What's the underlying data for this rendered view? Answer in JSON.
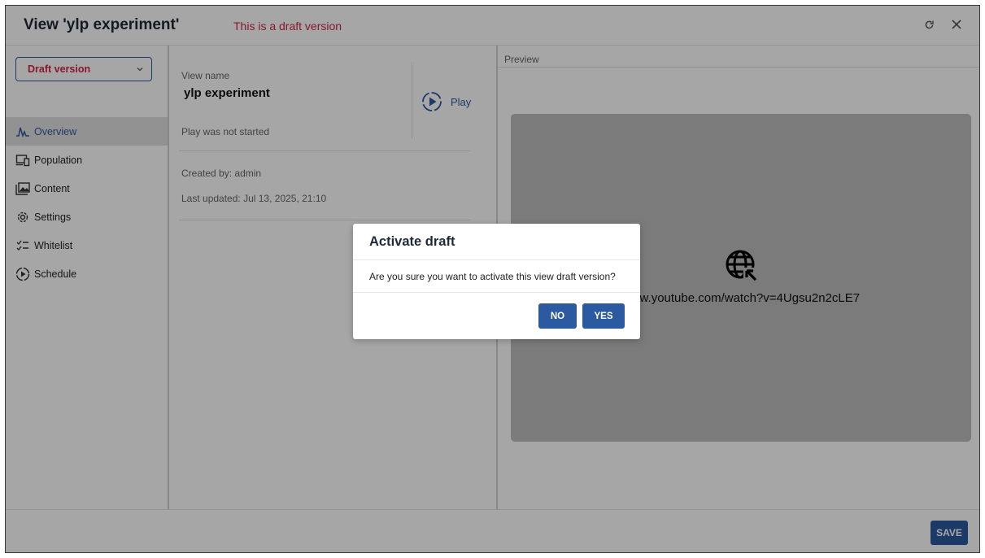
{
  "header": {
    "title": "View 'ylp experiment'",
    "draft_note": "This is a draft version",
    "icons": [
      "refresh-icon",
      "close-icon"
    ]
  },
  "sidebar": {
    "version_select": {
      "value": "Draft version"
    },
    "items": [
      {
        "label": "Overview",
        "icon": "activity-icon",
        "active": true
      },
      {
        "label": "Population",
        "icon": "devices-icon",
        "active": false
      },
      {
        "label": "Content",
        "icon": "folder-image-icon",
        "active": false
      },
      {
        "label": "Settings",
        "icon": "gear-icon",
        "active": false
      },
      {
        "label": "Whitelist",
        "icon": "checklist-icon",
        "active": false
      },
      {
        "label": "Schedule",
        "icon": "play-cycle-icon",
        "active": false
      }
    ]
  },
  "details": {
    "view_name_label": "View name",
    "view_name": "ylp experiment",
    "play_label": "Play",
    "play_status": "Play was not started",
    "created_by_label": "Created by:",
    "created_by": "admin",
    "last_updated_label": "Last updated:",
    "last_updated": "Jul 13, 2025, 21:10"
  },
  "preview": {
    "label": "Preview",
    "url": "www.youtube.com/watch?v=4Ugsu2n2cLE7"
  },
  "footer": {
    "save_label": "SAVE"
  },
  "modal": {
    "title": "Activate draft",
    "message": "Are you sure you want to activate this view draft version?",
    "no_label": "NO",
    "yes_label": "YES"
  },
  "colors": {
    "accent": "#2c5aa0",
    "draft_red": "#d0264a"
  }
}
